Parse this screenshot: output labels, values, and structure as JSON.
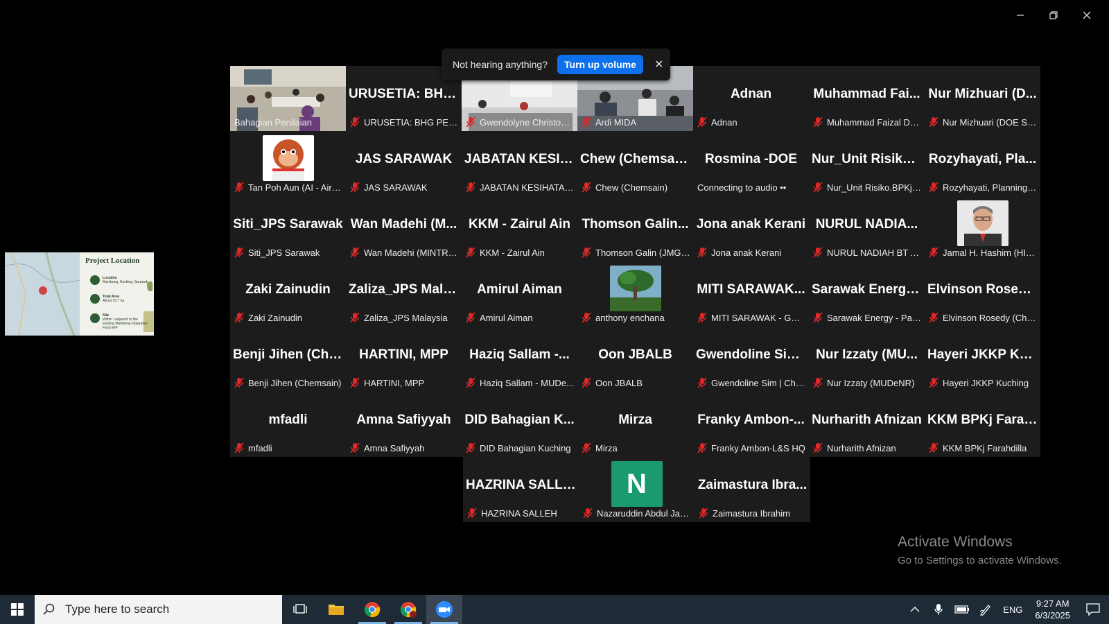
{
  "banner": {
    "message": "Not hearing anything?",
    "button": "Turn up volume"
  },
  "grid": {
    "rows": [
      [
        {
          "big": "",
          "name": "Bahagian Penilaian",
          "video": "room",
          "active": true,
          "mic": false
        },
        {
          "big": "URUSETIA: BHG...",
          "name": "URUSETIA: BHG PENIL...",
          "mic": true
        },
        {
          "big": "",
          "name": "Gwendolyne Christoph...",
          "video": "office",
          "mic": true
        },
        {
          "big": "",
          "name": "Ardi MIDA",
          "video": "meeting",
          "mic": true
        },
        {
          "big": "Adnan",
          "name": "Adnan",
          "mic": true
        },
        {
          "big": "Muhammad Fai...",
          "name": "Muhammad Faizal DO...",
          "mic": true
        },
        {
          "big": "Nur Mizhuari (D...",
          "name": "Nur Mizhuari (DOE Su...",
          "mic": true
        }
      ],
      [
        {
          "big": "",
          "name": "Tan Poh Aun (AI - Air Q...",
          "avatar": "monkey",
          "mic": true
        },
        {
          "big": "JAS SARAWAK",
          "name": "JAS SARAWAK",
          "mic": true
        },
        {
          "big": "JABATAN KESIH...",
          "name": "JABATAN KESIHATAN ...",
          "mic": true
        },
        {
          "big": "Chew (Chemsain)",
          "name": "Chew (Chemsain)",
          "mic": true
        },
        {
          "big": "Rosmina -DOE",
          "name": "Connecting to audio ••",
          "mic": false
        },
        {
          "big": "Nur_Unit Risiko....",
          "name": "Nur_Unit Risiko.BPKj.K...",
          "mic": true
        },
        {
          "big": "Rozyhayati, Pla...",
          "name": "Rozyhayati, Planning J...",
          "mic": true
        }
      ],
      [
        {
          "big": "Siti_JPS Sarawak",
          "name": "Siti_JPS Sarawak",
          "mic": true
        },
        {
          "big": "Wan Madehi (M...",
          "name": "Wan Madehi (MINTRE...",
          "mic": true
        },
        {
          "big": "KKM - Zairul Ain",
          "name": "KKM - Zairul Ain",
          "mic": true
        },
        {
          "big": "Thomson Galin...",
          "name": "Thomson Galin (JMG S...",
          "mic": true
        },
        {
          "big": "Jona anak Kerani",
          "name": "Jona anak Kerani",
          "mic": true
        },
        {
          "big": "NURUL NADIA...",
          "name": "NURUL NADIAH BT AH...",
          "mic": true
        },
        {
          "big": "",
          "name": "Jamal H. Hashim (HIA ...",
          "avatar": "man",
          "mic": true
        }
      ],
      [
        {
          "big": "Zaki Zainudin",
          "name": "Zaki Zainudin",
          "mic": true
        },
        {
          "big": "Zaliza_JPS Mala...",
          "name": "Zaliza_JPS Malaysia",
          "mic": true
        },
        {
          "big": "Amirul Aiman",
          "name": "Amirul Aiman",
          "mic": true
        },
        {
          "big": "",
          "name": "anthony enchana",
          "avatar": "tree",
          "mic": true
        },
        {
          "big": "MITI SARAWAK...",
          "name": "MITI SARAWAK - GRIF...",
          "mic": true
        },
        {
          "big": "Sarawak Energy...",
          "name": "Sarawak Energy - Pang...",
          "mic": true
        },
        {
          "big": "Elvinson Rosedy...",
          "name": "Elvinson Rosedy (Che...",
          "mic": true
        }
      ],
      [
        {
          "big": "Benji Jihen (Che...",
          "name": "Benji Jihen (Chemsain)",
          "mic": true
        },
        {
          "big": "HARTINI, MPP",
          "name": "HARTINI, MPP",
          "mic": true
        },
        {
          "big": "Haziq Sallam -...",
          "name": "Haziq Sallam - MUDe...",
          "mic": true
        },
        {
          "big": "Oon JBALB",
          "name": "Oon JBALB",
          "mic": true
        },
        {
          "big": "Gwendoline Sim...",
          "name": "Gwendoline Sim | Che...",
          "mic": true
        },
        {
          "big": "Nur Izzaty (MU...",
          "name": "Nur Izzaty (MUDeNR)",
          "mic": true
        },
        {
          "big": "Hayeri JKKP Ku...",
          "name": "Hayeri JKKP Kuching",
          "mic": true
        }
      ],
      [
        {
          "big": "mfadli",
          "name": "mfadli",
          "mic": true
        },
        {
          "big": "Amna Safiyyah",
          "name": "Amna Safiyyah",
          "mic": true
        },
        {
          "big": "DID Bahagian K...",
          "name": "DID Bahagian Kuching",
          "mic": true
        },
        {
          "big": "Mirza",
          "name": "Mirza",
          "mic": true
        },
        {
          "big": "Franky Ambon-...",
          "name": "Franky Ambon-L&S HQ",
          "mic": true
        },
        {
          "big": "Nurharith Afnizan",
          "name": "Nurharith Afnizan",
          "mic": true
        },
        {
          "big": "KKM BPKj Farah...",
          "name": "KKM BPKj Farahdilla",
          "mic": true
        }
      ]
    ],
    "extra_row": [
      {
        "big": "HAZRINA SALLEH",
        "name": "HAZRINA SALLEH",
        "mic": true
      },
      {
        "big": "",
        "name": "Nazaruddin Abdul Jabar",
        "avatar": "N",
        "mic": true
      },
      {
        "big": "Zaimastura Ibra...",
        "name": "Zaimastura Ibrahim",
        "mic": true
      }
    ]
  },
  "share": {
    "title": "Project Location",
    "items": [
      {
        "label": "Location",
        "sub": "Mambong, Kuching, Sarawak"
      },
      {
        "label": "Total Area",
        "sub": "About 15.7 ha"
      },
      {
        "label": "Site",
        "sub": "Within / adjacent to the existing Mambong Integrated Farm MIF"
      }
    ]
  },
  "watermark": {
    "line1": "Activate Windows",
    "line2": "Go to Settings to activate Windows."
  },
  "taskbar": {
    "search_placeholder": "Type here to search",
    "lang": "ENG",
    "time": "9:27 AM",
    "date": "6/3/2025"
  },
  "colors": {
    "active_tile": "#23d959",
    "volume_button": "#0e71eb",
    "mute": "#e02828",
    "taskbar": "#1e2a36"
  }
}
